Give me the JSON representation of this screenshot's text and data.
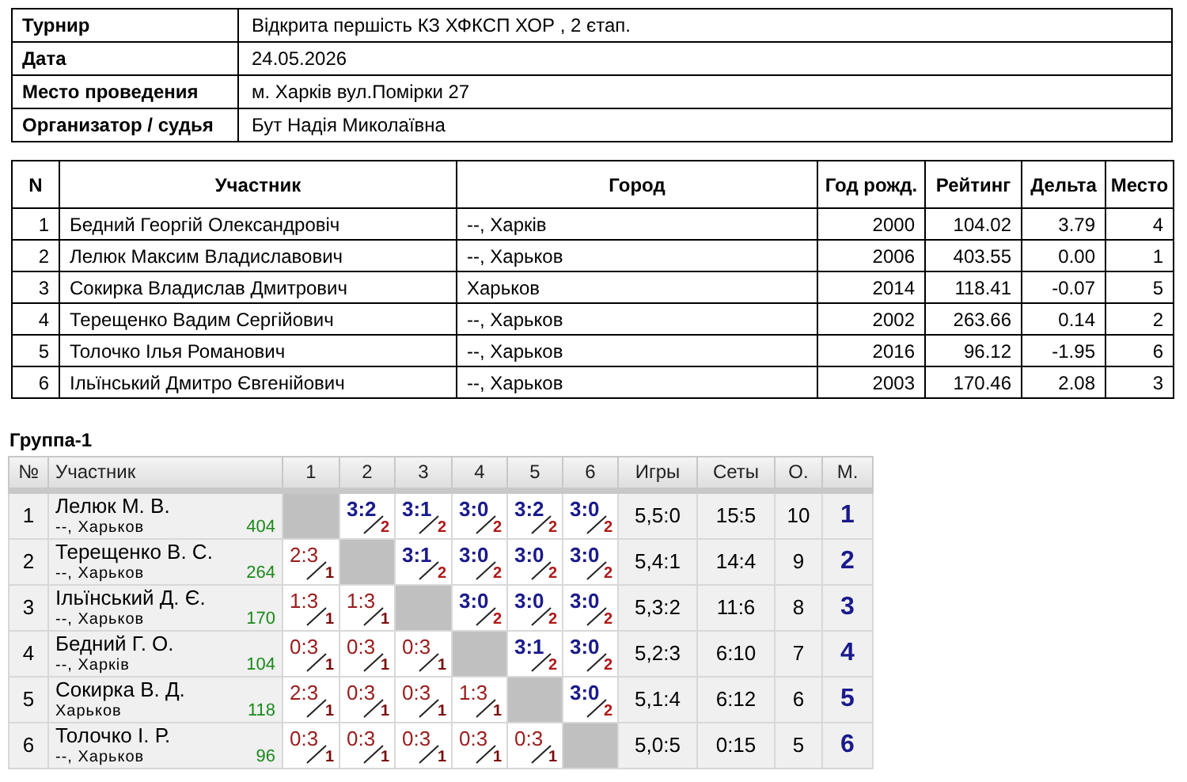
{
  "info": [
    {
      "label": "Турнир",
      "value": "Відкрита першість КЗ ХФКСП ХОР , 2 єтап."
    },
    {
      "label": "Дата",
      "value": "24.05.2026"
    },
    {
      "label": "Место проведения",
      "value": "м. Харків вул.Помірки 27"
    },
    {
      "label": "Организатор / судья",
      "value": "Бут Надія Миколаївна"
    }
  ],
  "participants": {
    "columns": [
      "N",
      "Участник",
      "Город",
      "Год рожд.",
      "Рейтинг",
      "Дельта",
      "Место"
    ],
    "rows": [
      [
        "1",
        "Бедний Георгій Олександровіч",
        "--, Харків",
        "2000",
        "104.02",
        "3.79",
        "4"
      ],
      [
        "2",
        "Лелюк Максим Владиславович",
        "--, Харьков",
        "2006",
        "403.55",
        "0.00",
        "1"
      ],
      [
        "3",
        "Сокирка Владислав Дмитрович",
        "Харьков",
        "2014",
        "118.41",
        "-0.07",
        "5"
      ],
      [
        "4",
        "Терещенко Вадим Сергійович",
        "--, Харьков",
        "2002",
        "263.66",
        "0.14",
        "2"
      ],
      [
        "5",
        "Толочко Ілья Романович",
        "--, Харьков",
        "2016",
        "96.12",
        "-1.95",
        "6"
      ],
      [
        "6",
        "Ільїнський Дмитро Євгенійович",
        "--, Харьков",
        "2003",
        "170.46",
        "2.08",
        "3"
      ]
    ]
  },
  "group": {
    "title": "Группа-1",
    "columns": [
      "№",
      "Участник",
      "1",
      "2",
      "3",
      "4",
      "5",
      "6",
      "Игры",
      "Сеты",
      "О.",
      "М."
    ],
    "rows": [
      [
        "1",
        {
          "name": "Лелюк М. В.",
          "city": "--, Харьков",
          "rating": "404"
        },
        {
          "kind": "self"
        },
        {
          "kind": "win",
          "score": "3:2",
          "pts": "2"
        },
        {
          "kind": "win",
          "score": "3:1",
          "pts": "2"
        },
        {
          "kind": "win",
          "score": "3:0",
          "pts": "2"
        },
        {
          "kind": "win",
          "score": "3:2",
          "pts": "2"
        },
        {
          "kind": "win",
          "score": "3:0",
          "pts": "2"
        },
        "5,5:0",
        "15:5",
        "10",
        "1"
      ],
      [
        "2",
        {
          "name": "Терещенко В. С.",
          "city": "--, Харьков",
          "rating": "264"
        },
        {
          "kind": "loss",
          "score": "2:3",
          "pts": "1"
        },
        {
          "kind": "self"
        },
        {
          "kind": "win",
          "score": "3:1",
          "pts": "2"
        },
        {
          "kind": "win",
          "score": "3:0",
          "pts": "2"
        },
        {
          "kind": "win",
          "score": "3:0",
          "pts": "2"
        },
        {
          "kind": "win",
          "score": "3:0",
          "pts": "2"
        },
        "5,4:1",
        "14:4",
        "9",
        "2"
      ],
      [
        "3",
        {
          "name": "Ільїнський Д. Є.",
          "city": "--, Харьков",
          "rating": "170"
        },
        {
          "kind": "loss",
          "score": "1:3",
          "pts": "1"
        },
        {
          "kind": "loss",
          "score": "1:3",
          "pts": "1"
        },
        {
          "kind": "self"
        },
        {
          "kind": "win",
          "score": "3:0",
          "pts": "2"
        },
        {
          "kind": "win",
          "score": "3:0",
          "pts": "2"
        },
        {
          "kind": "win",
          "score": "3:0",
          "pts": "2"
        },
        "5,3:2",
        "11:6",
        "8",
        "3"
      ],
      [
        "4",
        {
          "name": "Бедний Г. О.",
          "city": "--, Харків",
          "rating": "104"
        },
        {
          "kind": "loss",
          "score": "0:3",
          "pts": "1"
        },
        {
          "kind": "loss",
          "score": "0:3",
          "pts": "1"
        },
        {
          "kind": "loss",
          "score": "0:3",
          "pts": "1"
        },
        {
          "kind": "self"
        },
        {
          "kind": "win",
          "score": "3:1",
          "pts": "2"
        },
        {
          "kind": "win",
          "score": "3:0",
          "pts": "2"
        },
        "5,2:3",
        "6:10",
        "7",
        "4"
      ],
      [
        "5",
        {
          "name": "Сокирка В. Д.",
          "city": "Харьков",
          "rating": "118"
        },
        {
          "kind": "loss",
          "score": "2:3",
          "pts": "1"
        },
        {
          "kind": "loss",
          "score": "0:3",
          "pts": "1"
        },
        {
          "kind": "loss",
          "score": "0:3",
          "pts": "1"
        },
        {
          "kind": "loss",
          "score": "1:3",
          "pts": "1"
        },
        {
          "kind": "self"
        },
        {
          "kind": "win",
          "score": "3:0",
          "pts": "2"
        },
        "5,1:4",
        "6:12",
        "6",
        "5"
      ],
      [
        "6",
        {
          "name": "Толочко І. Р.",
          "city": "--, Харьков",
          "rating": "96"
        },
        {
          "kind": "loss",
          "score": "0:3",
          "pts": "1"
        },
        {
          "kind": "loss",
          "score": "0:3",
          "pts": "1"
        },
        {
          "kind": "loss",
          "score": "0:3",
          "pts": "1"
        },
        {
          "kind": "loss",
          "score": "0:3",
          "pts": "1"
        },
        {
          "kind": "loss",
          "score": "0:3",
          "pts": "1"
        },
        {
          "kind": "self"
        },
        "5,0:5",
        "0:15",
        "5",
        "6"
      ]
    ]
  }
}
